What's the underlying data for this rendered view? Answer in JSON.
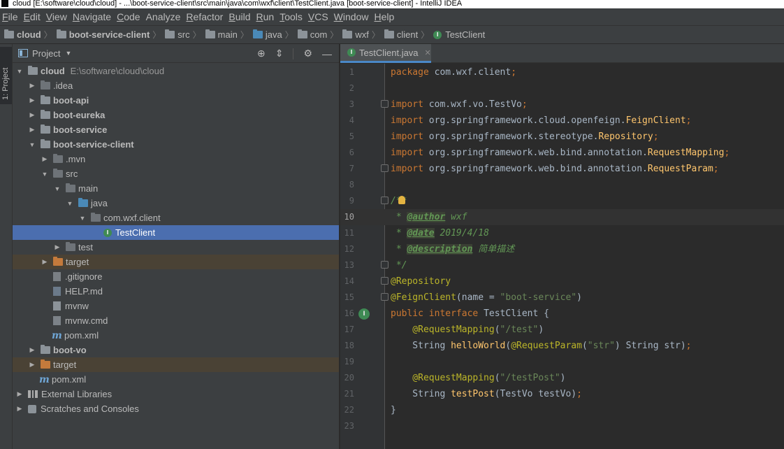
{
  "window": {
    "title": "cloud [E:\\software\\cloud\\cloud] - ...\\boot-service-client\\src\\main\\java\\com\\wxf\\client\\TestClient.java [boot-service-client] - IntelliJ IDEA"
  },
  "menu": [
    {
      "u": "F",
      "rest": "ile"
    },
    {
      "u": "E",
      "rest": "dit"
    },
    {
      "u": "V",
      "rest": "iew"
    },
    {
      "u": "N",
      "rest": "avigate"
    },
    {
      "u": "C",
      "rest": "ode"
    },
    {
      "u": "",
      "rest": "Analyze"
    },
    {
      "u": "R",
      "rest": "efactor"
    },
    {
      "u": "B",
      "rest": "uild"
    },
    {
      "u": "R",
      "rest": "un"
    },
    {
      "u": "T",
      "rest": "ools"
    },
    {
      "u": "V",
      "rest": "CS"
    },
    {
      "u": "W",
      "rest": "indow"
    },
    {
      "u": "H",
      "rest": "elp"
    }
  ],
  "breadcrumbs": [
    "cloud",
    "boot-service-client",
    "src",
    "main",
    "java",
    "com",
    "wxf",
    "client",
    "TestClient"
  ],
  "toolstrip": {
    "project_tab": "1: Project"
  },
  "project_panel": {
    "title": "Project",
    "tree": [
      {
        "label": "cloud",
        "hint": "E:\\software\\cloud\\cloud",
        "bold": true
      },
      {
        "label": ".idea"
      },
      {
        "label": "boot-api",
        "bold": true
      },
      {
        "label": "boot-eureka",
        "bold": true
      },
      {
        "label": "boot-service",
        "bold": true
      },
      {
        "label": "boot-service-client",
        "bold": true
      },
      {
        "label": ".mvn"
      },
      {
        "label": "src"
      },
      {
        "label": "main"
      },
      {
        "label": "java"
      },
      {
        "label": "com.wxf.client"
      },
      {
        "label": "TestClient"
      },
      {
        "label": "test"
      },
      {
        "label": "target"
      },
      {
        "label": ".gitignore"
      },
      {
        "label": "HELP.md"
      },
      {
        "label": "mvnw"
      },
      {
        "label": "mvnw.cmd"
      },
      {
        "label": "pom.xml"
      },
      {
        "label": "boot-vo",
        "bold": true
      },
      {
        "label": "target"
      },
      {
        "label": "pom.xml"
      },
      {
        "label": "External Libraries"
      },
      {
        "label": "Scratches and Consoles"
      }
    ]
  },
  "editor": {
    "tab_label": "TestClient.java",
    "line_numbers": [
      "1",
      "2",
      "3",
      "4",
      "5",
      "6",
      "7",
      "8",
      "9",
      "10",
      "11",
      "12",
      "13",
      "14",
      "15",
      "16",
      "17",
      "18",
      "19",
      "20",
      "21",
      "22",
      "23"
    ],
    "code": {
      "l1_kw": "package ",
      "l1_pk": "com.wxf.client",
      "l1_semi": ";",
      "l3_kw": "import ",
      "l3_pk": "com.wxf.vo.TestVo",
      "l3_semi": ";",
      "l4_kw": "import ",
      "l4_pk": "org.springframework.cloud.openfeign.",
      "l4_cls": "FeignClient",
      "l4_semi": ";",
      "l5_kw": "import ",
      "l5_pk": "org.springframework.stereotype.",
      "l5_cls": "Repository",
      "l5_semi": ";",
      "l6_kw": "import ",
      "l6_pk": "org.springframework.web.bind.annotation.",
      "l6_cls": "RequestMapping",
      "l6_semi": ";",
      "l7_kw": "import ",
      "l7_pk": "org.springframework.web.bind.annotation.",
      "l7_cls": "RequestParam",
      "l7_semi": ";",
      "l9_doc": "/**",
      "l10_pre": " * ",
      "l10_tag": "@author",
      "l10_val": " wxf",
      "l11_pre": " * ",
      "l11_tag": "@date",
      "l11_val": " 2019/4/18",
      "l12_pre": " * ",
      "l12_tag": "@description",
      "l12_val": " 简单描述",
      "l13_doc": " */",
      "l14_ann": "@Repository",
      "l15_ann": "@FeignClient",
      "l15_p1": "(name = ",
      "l15_str": "\"boot-service\"",
      "l15_p2": ")",
      "l16_kw": "public interface ",
      "l16_name": "TestClient",
      "l16_brace": " {",
      "l17_ann": "    @RequestMapping",
      "l17_p1": "(",
      "l17_str": "\"/test\"",
      "l17_p2": ")",
      "l18_type": "    String ",
      "l18_fn": "helloWorld",
      "l18_p1": "(",
      "l18_ann": "@RequestParam",
      "l18_p2": "(",
      "l18_str": "\"str\"",
      "l18_p3": ") String str)",
      "l18_semi": ";",
      "l20_ann": "    @RequestMapping",
      "l20_p1": "(",
      "l20_str": "\"/testPost\"",
      "l20_p2": ")",
      "l21_type": "    String ",
      "l21_fn": "testPost",
      "l21_p1": "(TestVo testVo)",
      "l21_semi": ";",
      "l22_brace": "}"
    }
  },
  "colors": {
    "selection": "#4b6eaf",
    "keyword": "#cc7832",
    "annotation": "#bbb529",
    "string": "#6a8759",
    "doc_comment": "#629755",
    "method": "#ffc66d"
  }
}
